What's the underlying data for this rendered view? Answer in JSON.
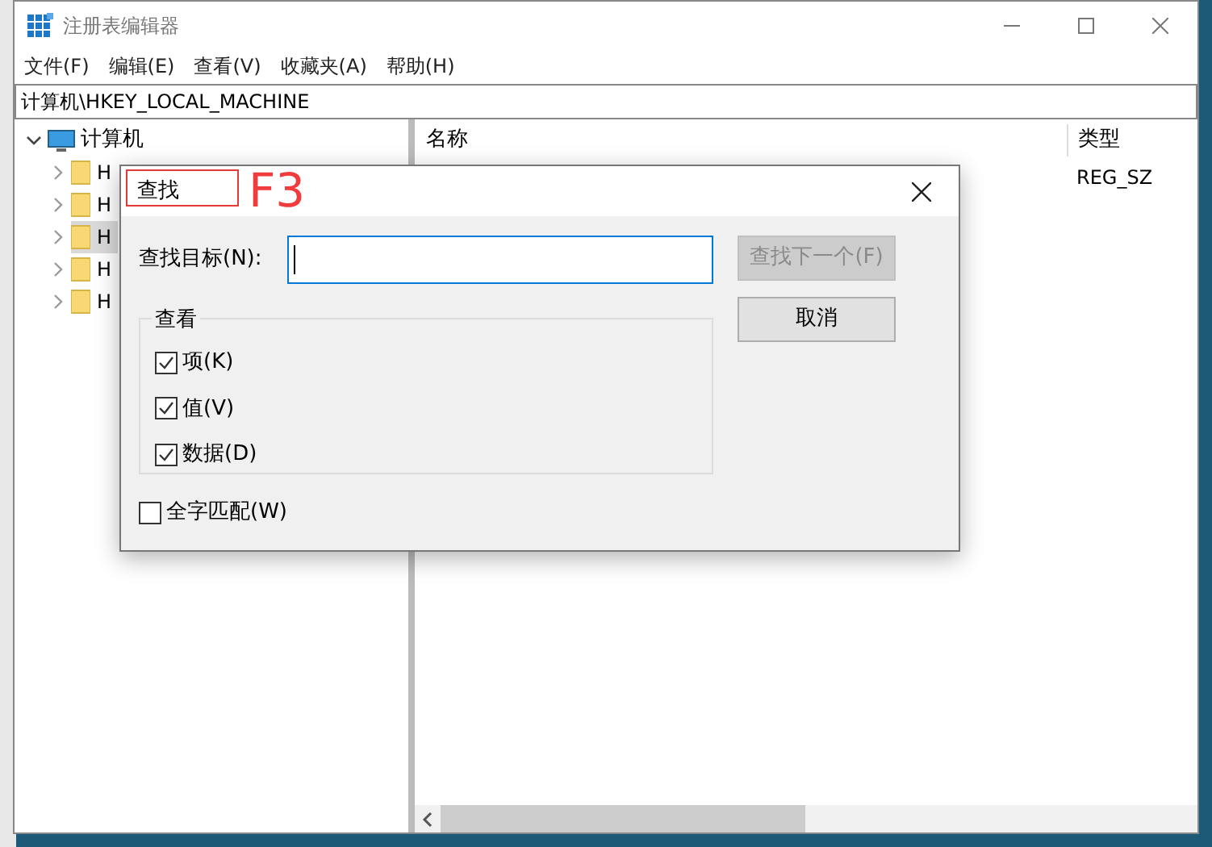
{
  "window": {
    "title": "注册表编辑器"
  },
  "menu": [
    {
      "label": "文件(F)"
    },
    {
      "label": "编辑(E)"
    },
    {
      "label": "查看(V)"
    },
    {
      "label": "收藏夹(A)"
    },
    {
      "label": "帮助(H)"
    }
  ],
  "address": "计算机\\HKEY_LOCAL_MACHINE",
  "tree": {
    "label": "计算机",
    "expanded": true,
    "children": [
      {
        "label": "H",
        "selected": false
      },
      {
        "label": "H",
        "selected": false
      },
      {
        "label": "H",
        "selected": true
      },
      {
        "label": "H",
        "selected": false
      },
      {
        "label": "H",
        "selected": false
      }
    ]
  },
  "list": {
    "columns": [
      "名称",
      "类型"
    ],
    "rows": [
      {
        "type": "REG_SZ"
      }
    ]
  },
  "find_dialog": {
    "title": "查找",
    "target_label": "查找目标(N):",
    "buttons": [
      {
        "label": "查找下一个(F)",
        "disabled": true
      },
      {
        "label": "取消",
        "disabled": false
      }
    ],
    "group": {
      "legend": "查看",
      "options": [
        {
          "label": "项(K)",
          "checked": true
        },
        {
          "label": "值(V)",
          "checked": true
        },
        {
          "label": "数据(D)",
          "checked": true
        }
      ]
    },
    "whole_word": {
      "label": "全字匹配(W)",
      "checked": false
    }
  },
  "annotation": {
    "text": "F3"
  }
}
